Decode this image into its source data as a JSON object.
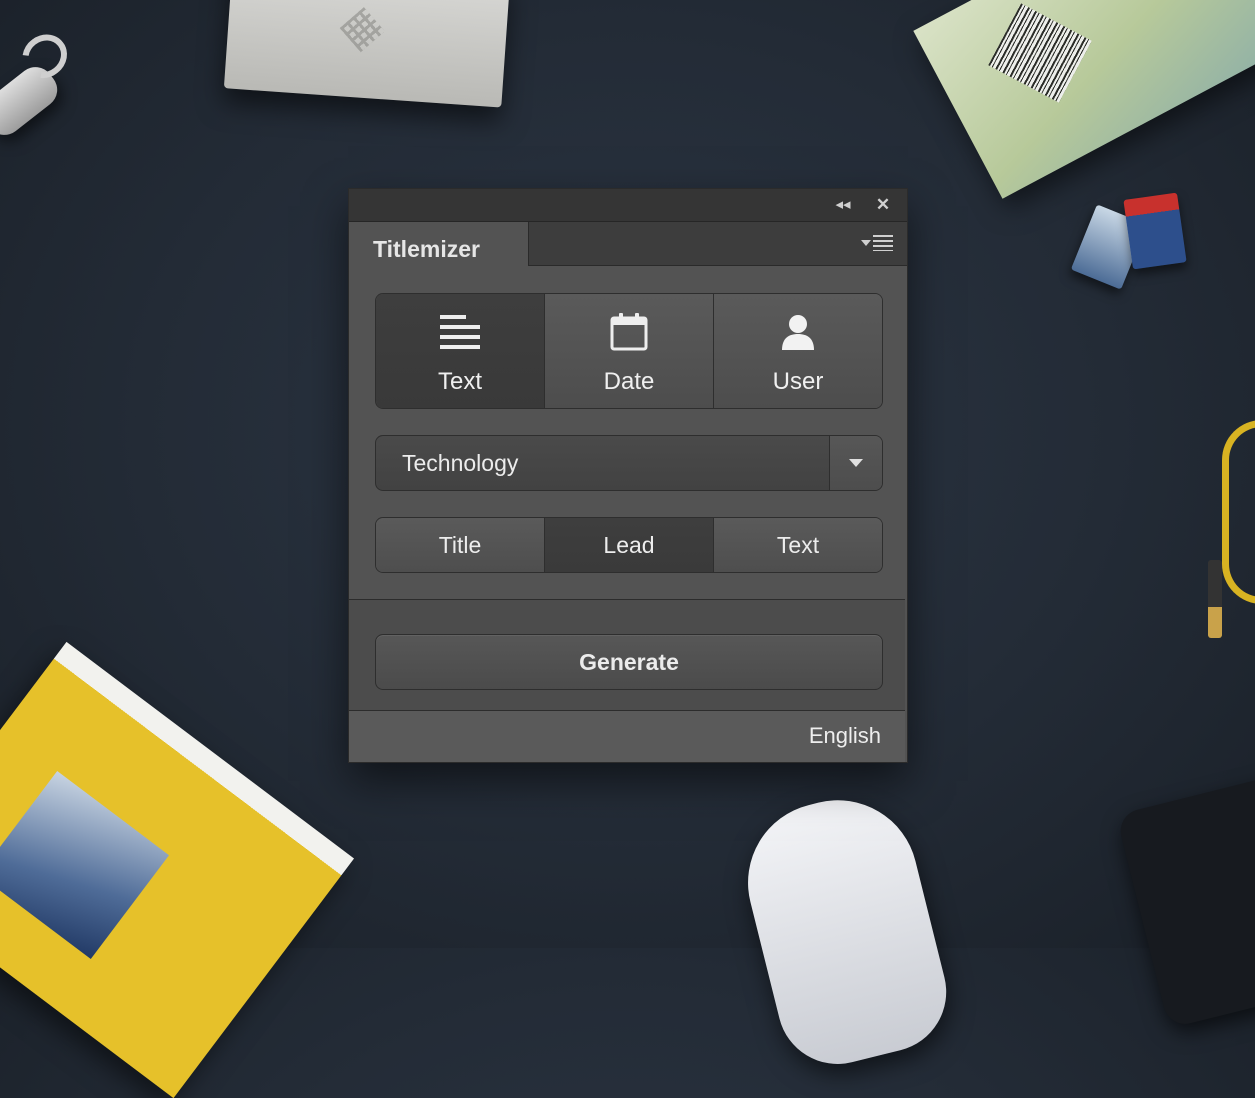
{
  "window": {
    "controls": {
      "collapse_glyph": "◂◂",
      "close_glyph": "✕"
    }
  },
  "panel": {
    "tab_title": "Titlemizer",
    "menu_icon": "panel-menu-icon"
  },
  "source_options": [
    {
      "label": "Text",
      "icon": "text-lines-icon",
      "selected": true
    },
    {
      "label": "Date",
      "icon": "calendar-icon",
      "selected": false
    },
    {
      "label": "User",
      "icon": "user-icon",
      "selected": false
    }
  ],
  "category": {
    "selected": "Technology"
  },
  "field_options": [
    {
      "label": "Title",
      "selected": false
    },
    {
      "label": "Lead",
      "selected": true
    },
    {
      "label": "Text",
      "selected": false
    }
  ],
  "actions": {
    "generate_label": "Generate"
  },
  "footer": {
    "language": "English"
  },
  "colors": {
    "panel_bg": "#535353",
    "selected_segment": "#3e3e3e",
    "text": "#ececec"
  }
}
